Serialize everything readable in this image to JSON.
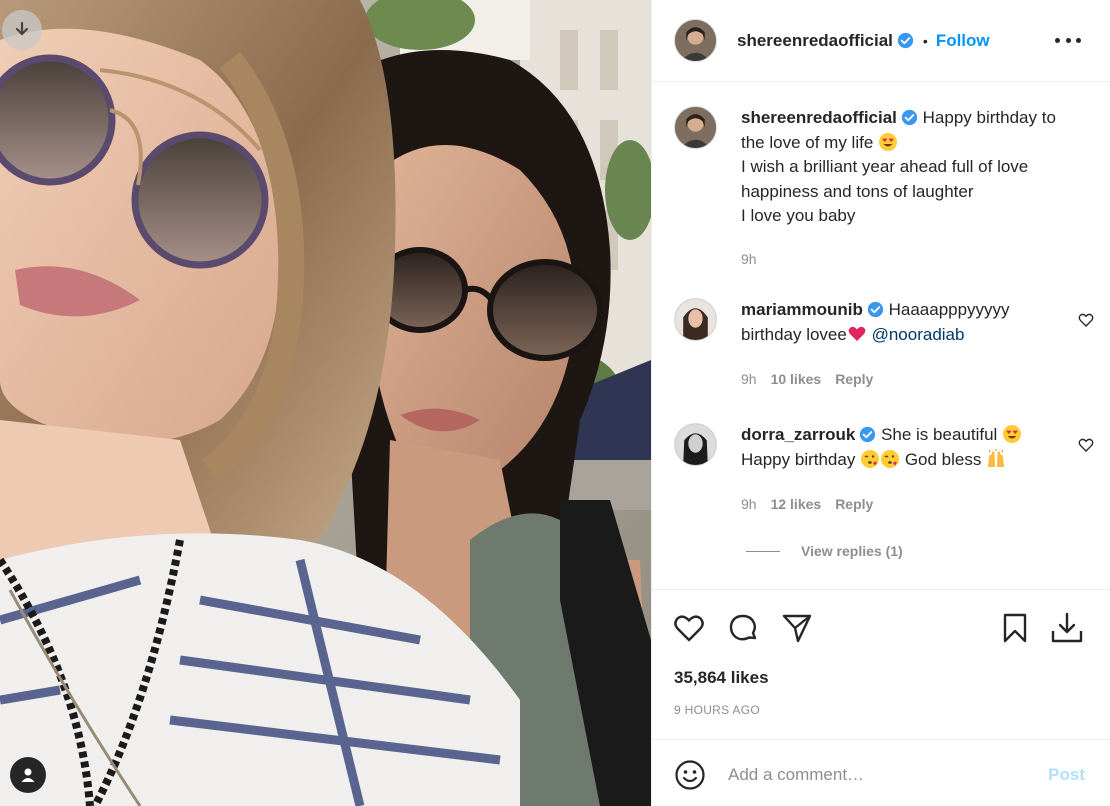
{
  "post": {
    "author": {
      "username": "shereenredaofficial",
      "verified": true,
      "follow_label": "Follow",
      "dot": "•"
    },
    "caption": {
      "username": "shereenredaofficial",
      "text_line1": "Happy birthday",
      "text_line2": "to the love of my life",
      "text_rest": "I wish a brilliant year ahead full of love\nhappiness and tons of laughter\nI love you baby",
      "emoji": "heart-eyes",
      "time": "9h"
    },
    "comments": [
      {
        "username": "mariammounib",
        "verified": true,
        "text_line1": "Haaaapppyyyyy",
        "text_line2": "birthday lovee",
        "emoji": "red-heart",
        "mention": "@nooradiab",
        "time": "9h",
        "likes": "10 likes",
        "reply": "Reply"
      },
      {
        "username": "dorra_zarrouk",
        "verified": true,
        "text_line1": "She is beautiful",
        "text_line2a": "Happy birthday",
        "text_line2b": "God bless",
        "emojis": [
          "heart-eyes",
          "kissing-face",
          "kissing-face",
          "raised-hands"
        ],
        "time": "9h",
        "likes": "12 likes",
        "reply": "Reply"
      }
    ],
    "view_replies": "View replies (1)",
    "likes": "35,864 likes",
    "time_ago": "9 HOURS AGO",
    "comment_box": {
      "placeholder": "Add a comment…",
      "post_label": "Post"
    },
    "icons": [
      "download-icon",
      "user-tag-icon",
      "heart-icon",
      "comment-icon",
      "share-icon",
      "save-icon",
      "download-post-icon",
      "emoji-icon",
      "more-options-icon",
      "verified-badge-icon"
    ],
    "colors": {
      "accent": "#0095f6",
      "post_disabled": "#b2dffc",
      "secondary_text": "#8e8e8e",
      "mention": "#00376b",
      "heart_red": "#ed4956"
    }
  }
}
